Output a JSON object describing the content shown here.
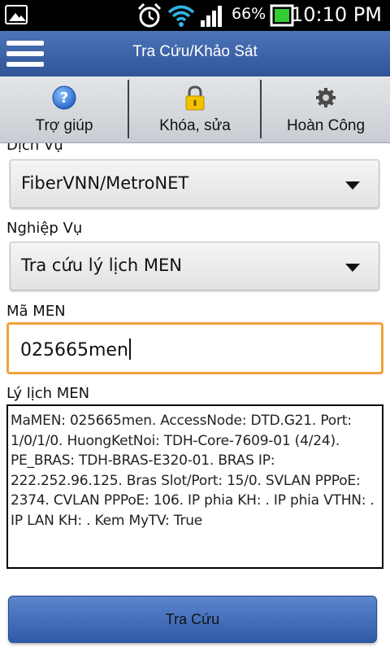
{
  "status_bar": {
    "battery_percent": "66%",
    "time": "10:10 PM",
    "icons": [
      "picture-thumbnail-icon",
      "alarm-icon",
      "wifi-icon",
      "signal-icon",
      "battery-icon"
    ]
  },
  "action_bar": {
    "title": "Tra Cứu/Khảo Sát",
    "menu_icon": "hamburger-menu-icon"
  },
  "toolbar": {
    "items": [
      {
        "label": "Trợ giúp",
        "icon": "help-icon"
      },
      {
        "label": "Khóa, sửa",
        "icon": "lock-icon"
      },
      {
        "label": "Hoàn Công",
        "icon": "gear-icon"
      }
    ]
  },
  "form": {
    "service_label": "Dịch Vụ",
    "service_value": "FiberVNN/MetroNET",
    "task_label": "Nghiệp Vụ",
    "task_value": "Tra cứu lý lịch MEN",
    "men_code_label": "Mã MEN",
    "men_code_value": "025665men",
    "profile_label": "Lý lịch MEN",
    "profile_text": "MaMEN: 025665men. AccessNode: DTD.G21. Port: 1/0/1/0. HuongKetNoi: TDH-Core-7609-01 (4/24). PE_BRAS: TDH-BRAS-E320-01. BRAS IP: 222.252.96.125. Bras Slot/Port: 15/0. SVLAN PPPoE: 2374. CVLAN PPPoE: 106. IP phia KH: . IP phia VTHN: . IP LAN KH: . Kem MyTV: True",
    "submit_label": "Tra Cứu"
  },
  "colors": {
    "action_bar": "#3c64a8",
    "input_focus_border": "#f0a23a",
    "button": "#4a74be"
  }
}
